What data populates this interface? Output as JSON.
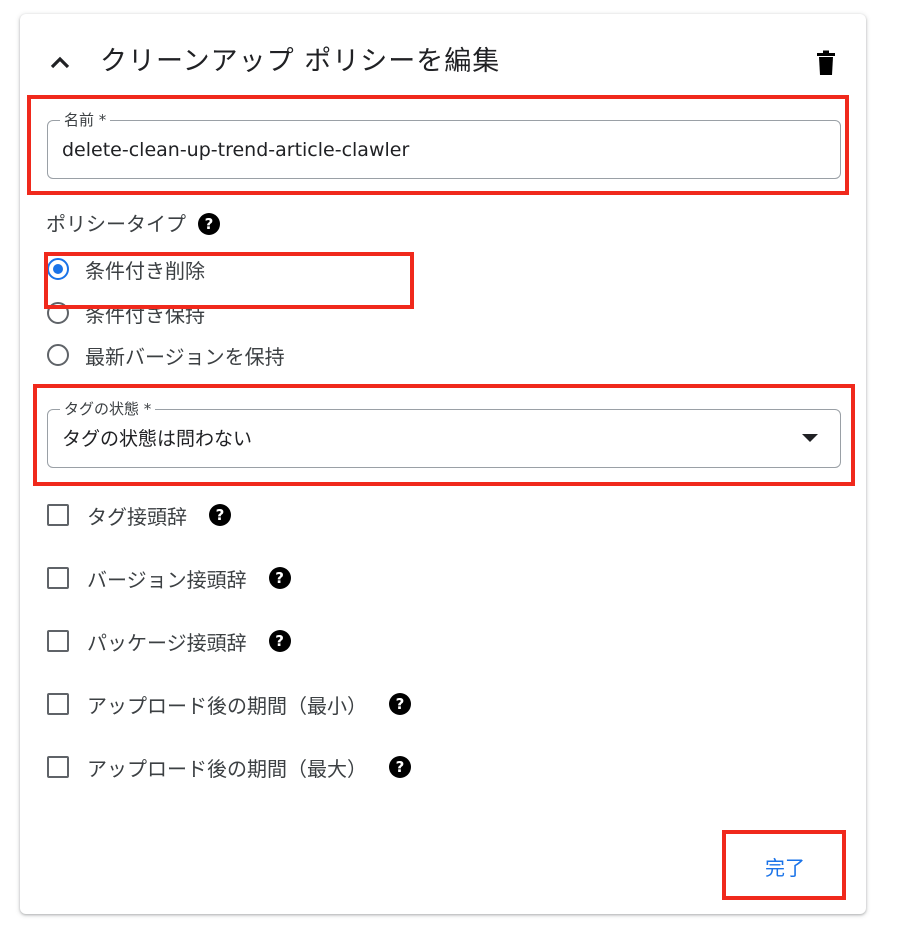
{
  "header": {
    "title": "クリーンアップ ポリシーを編集",
    "collapse_icon": "chevron-up-icon",
    "delete_icon": "trash-icon"
  },
  "name_field": {
    "label": "名前 *",
    "value": "delete-clean-up-trend-article-clawler"
  },
  "policy_type": {
    "label": "ポリシータイプ",
    "help_icon": "help-icon",
    "options": [
      {
        "label": "条件付き削除",
        "checked": true
      },
      {
        "label": "条件付き保持",
        "checked": false
      },
      {
        "label": "最新バージョンを保持",
        "checked": false
      }
    ]
  },
  "tag_state_field": {
    "label": "タグの状態 *",
    "value": "タグの状態は問わない"
  },
  "conditions": [
    {
      "label": "タグ接頭辞",
      "checked": false
    },
    {
      "label": "バージョン接頭辞",
      "checked": false
    },
    {
      "label": "パッケージ接頭辞",
      "checked": false
    },
    {
      "label": "アップロード後の期間（最小）",
      "checked": false
    },
    {
      "label": "アップロード後の期間（最大）",
      "checked": false
    }
  ],
  "actions": {
    "done_label": "完了"
  },
  "colors": {
    "accent": "#1a73e8",
    "highlight": "#f0291c"
  }
}
